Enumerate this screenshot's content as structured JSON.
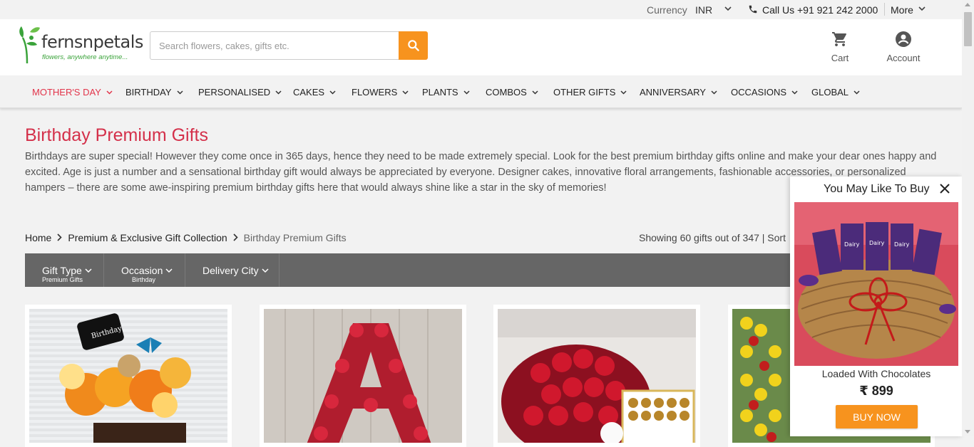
{
  "topbar": {
    "currency_label": "Currency",
    "currency_value": "INR",
    "call_text": "Call Us +91 921 242 2000",
    "more_label": "More"
  },
  "header": {
    "logo_brand": "fernsnpetals",
    "logo_tagline": "flowers, anywhere anytime...",
    "search_placeholder": "Search flowers, cakes, gifts etc.",
    "cart_label": "Cart",
    "account_label": "Account"
  },
  "nav": {
    "items": [
      {
        "label": "MOTHER'S DAY"
      },
      {
        "label": "BIRTHDAY"
      },
      {
        "label": "PERSONALISED"
      },
      {
        "label": "CAKES"
      },
      {
        "label": "FLOWERS"
      },
      {
        "label": "PLANTS"
      },
      {
        "label": "COMBOS"
      },
      {
        "label": "OTHER GIFTS"
      },
      {
        "label": "ANNIVERSARY"
      },
      {
        "label": "OCCASIONS"
      },
      {
        "label": "GLOBAL"
      }
    ]
  },
  "page": {
    "title": "Birthday Premium Gifts",
    "intro": "Birthdays are super special! However they come once in 365 days, hence they need to be made extremely special. Look for the best premium birthday gifts online and make your dear ones happy and excited. Age is just a number and a sensational birthday gift would always be appreciated by everyone. Designer cakes, innovative floral arrangements, fashionable accessories, or personalized hampers – there are some awe-inspiring premium birthday gifts here that would always shine like a star in the sky of memories!"
  },
  "breadcrumb": {
    "items": [
      "Home",
      "Premium & Exclusive Gift Collection",
      "Birthday Premium Gifts"
    ]
  },
  "listing": {
    "showing": "Showing 60 gifts out of 347 |  Sort"
  },
  "filters": [
    {
      "title": "Gift Type",
      "sub": "Premium Gifts"
    },
    {
      "title": "Occasion",
      "sub": "Birthday"
    },
    {
      "title": "Delivery City",
      "sub": ""
    }
  ],
  "popup": {
    "title": "You May Like To Buy",
    "product_name": "Loaded With Chocolates",
    "price": "₹ 899",
    "button": "BUY NOW"
  },
  "colors": {
    "accent_orange": "#f7931e",
    "title_red": "#d4304a",
    "nav_active": "#e2344a",
    "brand_green": "#3aa33a",
    "filter_bar": "#666666"
  }
}
